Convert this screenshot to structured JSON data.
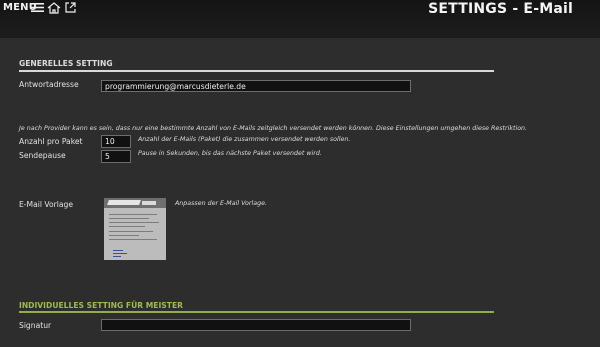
{
  "header": {
    "menu_label": "MENU",
    "title": "SETTINGS - E-Mail",
    "icons": [
      "hamburger-icon",
      "home-icon",
      "external-link-icon"
    ]
  },
  "colors": {
    "section1": "#dcdcdc",
    "section2": "#9dbb4f",
    "rule1": "#d8d8d8",
    "rule2": "#8fb049"
  },
  "general": {
    "heading": "GENERELLES SETTING",
    "reply_label": "Antwortadresse",
    "reply_value": "programmierung@marcusdieterle.de",
    "provider_note": "Je nach Provider kann es sein, dass nur eine bestimmte Anzahl von E-Mails zeitgleich versendet werden können. Diese Einstellungen umgehen diese Restriktion.",
    "count_label": "Anzahl  pro Paket",
    "count_value": "10",
    "count_hint": "Anzahl der E-Mails (Paket) die zusammen versendet werden sollen.",
    "pause_label": "Sendepause",
    "pause_value": "5",
    "pause_hint": "Pause in Sekunden, bis das nächste Paket versendet wird.",
    "template_label": "E-Mail Vorlage",
    "template_hint": "Anpassen der E-Mail Vorlage."
  },
  "individual": {
    "heading": "INDIVIDUELLES SETTING FÜR MEISTER",
    "signature_label": "Signatur",
    "signature_value": ""
  }
}
